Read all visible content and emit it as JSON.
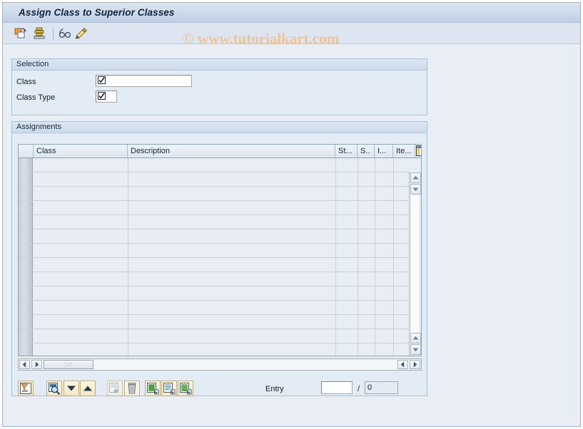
{
  "window": {
    "title": "Assign Class to Superior Classes"
  },
  "watermark": {
    "text": "© www.tutorialkart.com"
  },
  "toolbar": {
    "items": [
      {
        "name": "create-copy-icon",
        "tooltip": "Create"
      },
      {
        "name": "print-stack-icon",
        "tooltip": "Print"
      },
      {
        "name": "display-glasses-icon",
        "tooltip": "Display"
      },
      {
        "name": "edit-pencil-icon",
        "tooltip": "Change"
      }
    ]
  },
  "selection": {
    "title": "Selection",
    "fields": [
      {
        "label": "Class",
        "value": "",
        "placeholder": ""
      },
      {
        "label": "Class Type",
        "value": "",
        "placeholder": ""
      }
    ]
  },
  "assignments": {
    "title": "Assignments",
    "columns": [
      {
        "key": "rownum",
        "label": ""
      },
      {
        "key": "class",
        "label": "Class"
      },
      {
        "key": "description",
        "label": "Description"
      },
      {
        "key": "status",
        "label": "St..."
      },
      {
        "key": "s",
        "label": "S.."
      },
      {
        "key": "i",
        "label": "I..."
      },
      {
        "key": "item",
        "label": "Ite..."
      }
    ],
    "config_icon": "table-settings-icon",
    "rows": [],
    "visible_row_count": 14,
    "scrollbars": {
      "vertical": {
        "name": "table-vertical-scrollbar"
      },
      "horizontal": {
        "name": "table-horizontal-scrollbar"
      }
    }
  },
  "footer": {
    "buttons": [
      {
        "name": "selection-criteria-button",
        "icon": "filter-note-icon",
        "enabled": true
      },
      {
        "name": "find-button",
        "icon": "search-magnifier-icon",
        "enabled": true
      },
      {
        "name": "find-next-down-button",
        "icon": "triangle-down-icon",
        "enabled": true
      },
      {
        "name": "find-previous-up-button",
        "icon": "triangle-up-icon",
        "enabled": true
      },
      {
        "name": "insert-row-button",
        "icon": "insert-row-icon",
        "enabled": false
      },
      {
        "name": "delete-row-button",
        "icon": "trash-icon",
        "enabled": true
      },
      {
        "name": "copy-row-button",
        "icon": "copy-document-green-icon",
        "enabled": true
      },
      {
        "name": "paste-row-button",
        "icon": "paste-document-icon",
        "enabled": true
      },
      {
        "name": "cut-row-button",
        "icon": "cut-document-green-icon",
        "enabled": true
      }
    ],
    "entry": {
      "label": "Entry",
      "current_value": "",
      "separator": "/",
      "total_value": "0"
    }
  },
  "colors": {
    "window_background": "#e9eef5",
    "title_gradient_top": "#dbe6f2",
    "title_gradient_bottom": "#bdcfe4",
    "group_border": "#a9bfd4",
    "grid_row_background": "#e9eef5",
    "watermark": "#f0c394",
    "button_face": "#f6efd5"
  }
}
